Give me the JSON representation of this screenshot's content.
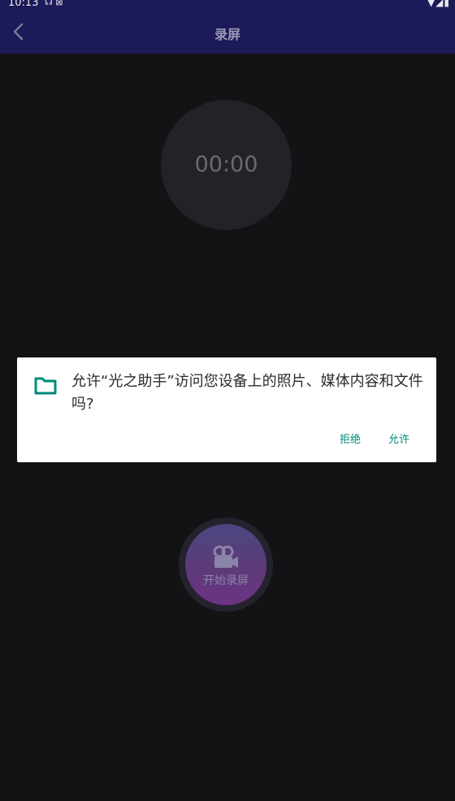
{
  "status_bar": {
    "time": "10:13",
    "left_icons": "☊ ⊠",
    "right_icons": "▼◢▮"
  },
  "header": {
    "back_icon": "chevron-left",
    "title": "录屏"
  },
  "timer": {
    "value": "00:00"
  },
  "record_button": {
    "icon": "video-camera",
    "label": "开始录屏"
  },
  "permission_dialog": {
    "icon": "folder",
    "message": "允许“光之助手”访问您设备上的照片、媒体内容和文件吗?",
    "deny_label": "拒绝",
    "allow_label": "允许",
    "accent_color": "#00897b"
  }
}
